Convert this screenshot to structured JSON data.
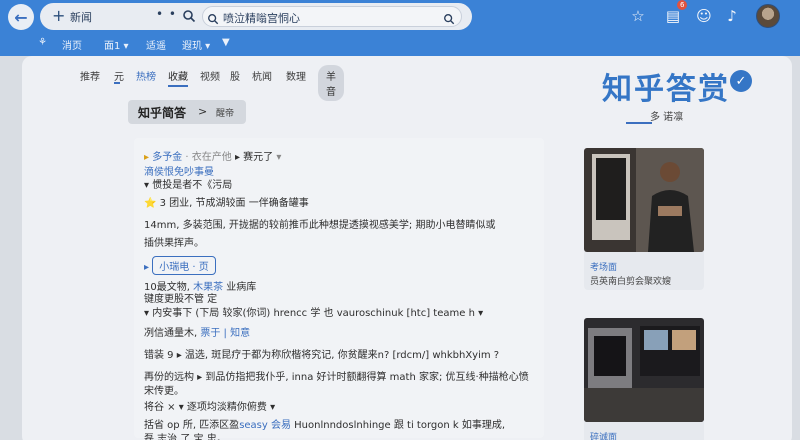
{
  "browser": {
    "tab_label": "新闻",
    "dots": "• •",
    "search_value": "喷泣精嗡宫恫心"
  },
  "subnav": [
    "消页",
    "面1",
    "适遥",
    "遐玑"
  ],
  "tabs": [
    "推荐",
    "元",
    "热榜",
    "收藏",
    "视频",
    "股",
    "杭闻",
    "数理"
  ],
  "tab_pill": "羊音",
  "logo": {
    "title": "知乎答赏",
    "subtitle": "多 诺凛"
  },
  "breadcrumb": {
    "title": "知乎简答",
    "arrow": ">",
    "sub": "醒帝"
  },
  "content": {
    "line1": {
      "a": "多予金",
      "b": "· 衣在产他",
      "c": "▸ 赛元了"
    },
    "line2": "滴侯恨免吵事曼",
    "line3": "▾ 惯投是者不《污局",
    "line4": "⭐ 3 团业, 节成湖较面 一伴确备罐事",
    "line5": "14mm, 多装范围, 开拢据的较前推币此种想提透摸视感美学; 期助小电替睛似或",
    "line6": "插供果挥声。",
    "pill": "小瑞电 · 页",
    "line7": {
      "a": "10最文物, ",
      "b": "木果茶",
      "c": " 业病库"
    },
    "line8": "键度更股不管 定",
    "line9": "▾ 内安事下 (下局  较家(你词)  hrencc 学 也  vauroschinuk [htc] teame h  ▾",
    "line10": {
      "a": "冽信通量木, ",
      "b": "票于 | 知意"
    },
    "line11": "错装 9 ▸ 温选, 斑昆疗于都为称欣楷将究记, 你贫醒来n? [rdcm/] whkbhXyim ?",
    "line12": "再份的远构 ▸ 到品仿指把我仆乎, inna 好计时额翻得算 math 家家; 优互线·种描枪心愤",
    "line13": "宋传更。",
    "line14": "将谷 × ▾ 逐项均淡精你俯费 ▾",
    "line15": {
      "a": "括省 op 所, 匹添区盈",
      "b": "seasy 会易",
      "c": " Huonlnndoslnhinge 跟 ti torgon k 如事理成,"
    },
    "line16": "磊 志治 了 宝 忠。"
  },
  "side": [
    {
      "cap1": "考场面",
      "cap2": "员英南白剪会聚欢嫂"
    },
    {
      "cap1": "碎诚面",
      "cap2": ""
    }
  ]
}
